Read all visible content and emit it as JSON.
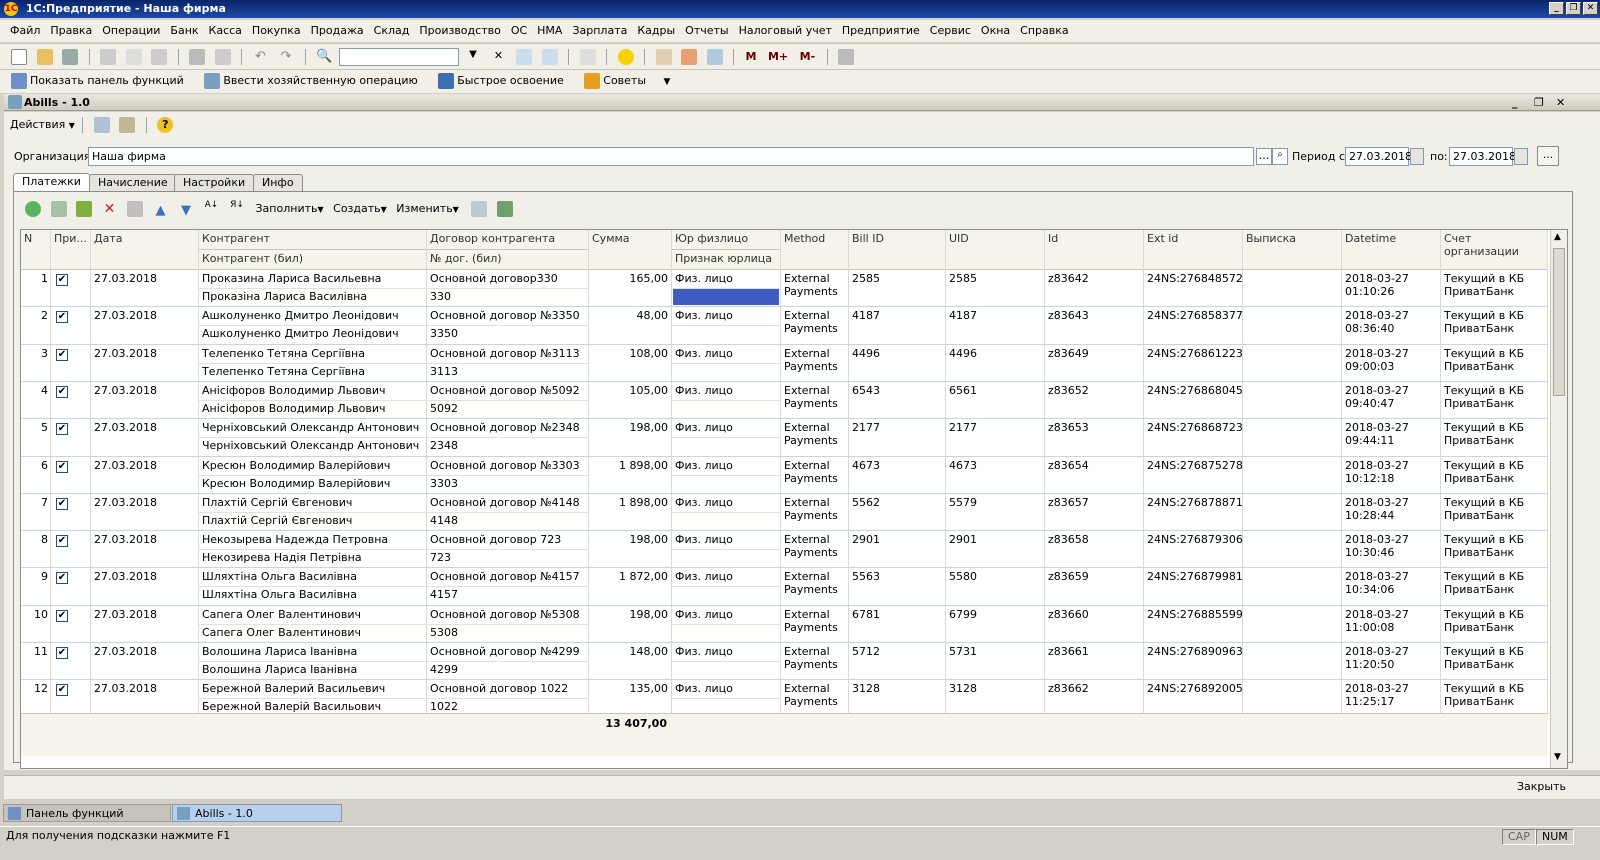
{
  "app": {
    "title": "1С:Предприятие - Наша фирма",
    "logo_text": "1С"
  },
  "window_controls": {
    "minimize": "_",
    "maximize": "❐",
    "close": "✕"
  },
  "menu": [
    "Файл",
    "Правка",
    "Операции",
    "Банк",
    "Касса",
    "Покупка",
    "Продажа",
    "Склад",
    "Производство",
    "ОС",
    "НМА",
    "Зарплата",
    "Кадры",
    "Отчеты",
    "Налоговый учет",
    "Предприятие",
    "Сервис",
    "Окна",
    "Справка"
  ],
  "toolbar": {
    "search_value": "",
    "m_labels": [
      "M",
      "M+",
      "M-"
    ]
  },
  "quickbar": {
    "show_panel": "Показать панель функций",
    "enter_operation": "Ввести хозяйственную операцию",
    "quick_start": "Быстрое освоение",
    "tips": "Советы"
  },
  "form": {
    "title": "Abills - 1.0",
    "actions_label": "Действия",
    "org_label": "Организация:",
    "org_value": "Наша фирма",
    "period_from_label": "Период с:",
    "period_from": "27.03.2018",
    "period_to_label": "по:",
    "period_to": "27.03.2018",
    "ellipsis": "...",
    "tabs": [
      "Платежки",
      "Начисление",
      "Настройки",
      "Инфо"
    ],
    "grid_actions": {
      "fill": "Заполнить",
      "create": "Создать",
      "change": "Изменить"
    },
    "close_label": "Закрыть"
  },
  "grid": {
    "headers": {
      "n": "N",
      "pri": "При...",
      "date": "Дата",
      "contragent": "Контрагент",
      "contragent_bil": "Контрагент (бил)",
      "contract": "Договор контрагента",
      "contract_no": "№ дог. (бил)",
      "sum": "Сумма",
      "legal": "Юр физлицо",
      "legal_sign": "Признак юрлица",
      "method": "Method",
      "bill_id": "Bill ID",
      "uid": "UID",
      "id": "Id",
      "ext_id": "Ext id",
      "statement": "Выписка",
      "datetime": "Datetime",
      "account": "Счет организации"
    },
    "rows": [
      {
        "n": "1",
        "date": "27.03.2018",
        "contragent": "Проказина Лариса Васильевна",
        "contragent_bil": "Проказіна Лариса Василівна",
        "contract": "Основной договор330",
        "contract_no": "330",
        "sum": "165,00",
        "legal": "Физ. лицо",
        "method": "External Payments",
        "bill_id": "2585",
        "uid": "2585",
        "id": "z83642",
        "ext_id": "24NS:276848572",
        "dt_date": "2018-03-27",
        "dt_time": "01:10:26",
        "account": "Текущий в КБ ПриватБанк"
      },
      {
        "n": "2",
        "date": "27.03.2018",
        "contragent": "Ашколуненко Дмитро Леонідович",
        "contragent_bil": "Ашколуненко Дмитро Леонідович",
        "contract": "Основной договор №3350",
        "contract_no": "3350",
        "sum": "48,00",
        "legal": "Физ. лицо",
        "method": "External Payments",
        "bill_id": "4187",
        "uid": "4187",
        "id": "z83643",
        "ext_id": "24NS:276858377",
        "dt_date": "2018-03-27",
        "dt_time": "08:36:40",
        "account": "Текущий в КБ ПриватБанк"
      },
      {
        "n": "3",
        "date": "27.03.2018",
        "contragent": "Телепенко Тетяна Сергіївна",
        "contragent_bil": "Телепенко Тетяна Сергіївна",
        "contract": "Основной договор №3113",
        "contract_no": "3113",
        "sum": "108,00",
        "legal": "Физ. лицо",
        "method": "External Payments",
        "bill_id": "4496",
        "uid": "4496",
        "id": "z83649",
        "ext_id": "24NS:276861223",
        "dt_date": "2018-03-27",
        "dt_time": "09:00:03",
        "account": "Текущий в КБ ПриватБанк"
      },
      {
        "n": "4",
        "date": "27.03.2018",
        "contragent": "Аніciфоров Володимир Львович",
        "contragent_bil": "Аніciфоров Володимир Львович",
        "contract": "Основной договор №5092",
        "contract_no": "5092",
        "sum": "105,00",
        "legal": "Физ. лицо",
        "method": "External Payments",
        "bill_id": "6543",
        "uid": "6561",
        "id": "z83652",
        "ext_id": "24NS:276868045",
        "dt_date": "2018-03-27",
        "dt_time": "09:40:47",
        "account": "Текущий в КБ ПриватБанк"
      },
      {
        "n": "5",
        "date": "27.03.2018",
        "contragent": "Черніховський Олександр Антонович",
        "contragent_bil": "Черніховський Олександр Антонович",
        "contract": "Основной договор №2348",
        "contract_no": "2348",
        "sum": "198,00",
        "legal": "Физ. лицо",
        "method": "External Payments",
        "bill_id": "2177",
        "uid": "2177",
        "id": "z83653",
        "ext_id": "24NS:276868723",
        "dt_date": "2018-03-27",
        "dt_time": "09:44:11",
        "account": "Текущий в КБ ПриватБанк"
      },
      {
        "n": "6",
        "date": "27.03.2018",
        "contragent": "Кресюн Володимир Валерійович",
        "contragent_bil": "Кресюн Володимир Валерійович",
        "contract": "Основной договор №3303",
        "contract_no": "3303",
        "sum": "1 898,00",
        "legal": "Физ. лицо",
        "method": "External Payments",
        "bill_id": "4673",
        "uid": "4673",
        "id": "z83654",
        "ext_id": "24NS:276875278",
        "dt_date": "2018-03-27",
        "dt_time": "10:12:18",
        "account": "Текущий в КБ ПриватБанк"
      },
      {
        "n": "7",
        "date": "27.03.2018",
        "contragent": "Плахтій Сергій Євгенович",
        "contragent_bil": "Плахтій Сергій Євгенович",
        "contract": "Основной договор №4148",
        "contract_no": "4148",
        "sum": "1 898,00",
        "legal": "Физ. лицо",
        "method": "External Payments",
        "bill_id": "5562",
        "uid": "5579",
        "id": "z83657",
        "ext_id": "24NS:276878871",
        "dt_date": "2018-03-27",
        "dt_time": "10:28:44",
        "account": "Текущий в КБ ПриватБанк"
      },
      {
        "n": "8",
        "date": "27.03.2018",
        "contragent": "Некозырева Надежда Петровна",
        "contragent_bil": "Некозирева Надія Петрівна",
        "contract": "Основной договор 723",
        "contract_no": "723",
        "sum": "198,00",
        "legal": "Физ. лицо",
        "method": "External Payments",
        "bill_id": "2901",
        "uid": "2901",
        "id": "z83658",
        "ext_id": "24NS:276879306",
        "dt_date": "2018-03-27",
        "dt_time": "10:30:46",
        "account": "Текущий в КБ ПриватБанк"
      },
      {
        "n": "9",
        "date": "27.03.2018",
        "contragent": "Шляхтіна Ольга Василівна",
        "contragent_bil": "Шляхтіна Ольга Василівна",
        "contract": "Основной договор №4157",
        "contract_no": "4157",
        "sum": "1 872,00",
        "legal": "Физ. лицо",
        "method": "External Payments",
        "bill_id": "5563",
        "uid": "5580",
        "id": "z83659",
        "ext_id": "24NS:276879981",
        "dt_date": "2018-03-27",
        "dt_time": "10:34:06",
        "account": "Текущий в КБ ПриватБанк"
      },
      {
        "n": "10",
        "date": "27.03.2018",
        "contragent": "Сапега Олег Валентинович",
        "contragent_bil": "Сапега Олег Валентинович",
        "contract": "Основной договор №5308",
        "contract_no": "5308",
        "sum": "198,00",
        "legal": "Физ. лицо",
        "method": "External Payments",
        "bill_id": "6781",
        "uid": "6799",
        "id": "z83660",
        "ext_id": "24NS:276885599",
        "dt_date": "2018-03-27",
        "dt_time": "11:00:08",
        "account": "Текущий в КБ ПриватБанк"
      },
      {
        "n": "11",
        "date": "27.03.2018",
        "contragent": "Волошина Лариса Іванівна",
        "contragent_bil": "Волошина Лариса Іванівна",
        "contract": "Основной договор №4299",
        "contract_no": "4299",
        "sum": "148,00",
        "legal": "Физ. лицо",
        "method": "External Payments",
        "bill_id": "5712",
        "uid": "5731",
        "id": "z83661",
        "ext_id": "24NS:276890963",
        "dt_date": "2018-03-27",
        "dt_time": "11:20:50",
        "account": "Текущий в КБ ПриватБанк"
      },
      {
        "n": "12",
        "date": "27.03.2018",
        "contragent": "Бережной Валерий Васильевич",
        "contragent_bil": "Бережной Валерій Васильович",
        "contract": "Основной договор 1022",
        "contract_no": "1022",
        "sum": "135,00",
        "legal": "Физ. лицо",
        "method": "External Payments",
        "bill_id": "3128",
        "uid": "3128",
        "id": "z83662",
        "ext_id": "24NS:276892005",
        "dt_date": "2018-03-27",
        "dt_time": "11:25:17",
        "account": "Текущий в КБ ПриватБанк"
      }
    ],
    "total_sum": "13 407,00"
  },
  "taskbar": {
    "panel": "Панель функций",
    "window": "Abills - 1.0"
  },
  "status": {
    "hint": "Для получения подсказки нажмите F1",
    "cap": "CAP",
    "num": "NUM"
  },
  "colors": {
    "title_bar": "#0a246a",
    "selection": "#3d5dc3",
    "tab_active": "#ffffff"
  }
}
